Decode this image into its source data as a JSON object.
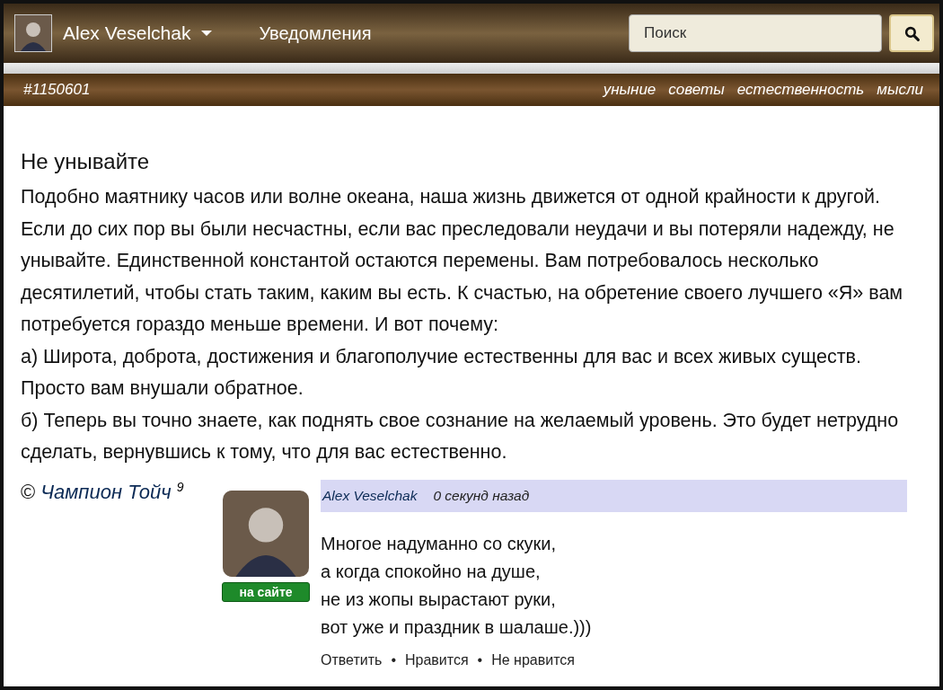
{
  "header": {
    "user": "Alex Veselchak",
    "notifications": "Уведомления",
    "search": {
      "placeholder": "Поиск"
    }
  },
  "post_bar": {
    "id": "#1150601",
    "tags": [
      "уныние",
      "советы",
      "естественность",
      "мысли"
    ]
  },
  "post": {
    "title": "Не унывайте",
    "paragraphs": [
      "Подобно маятнику часов или волне океана, наша жизнь движется от одной крайности к другой. Если до сих пор вы были несчастны, если вас преследовали неудачи и вы потеряли надежду, не унывайте. Единственной константой остаются перемены. Вам потребовалось несколько десятилетий, чтобы стать таким, каким вы есть. К счастью, на обретение своего лучшего «Я» вам потребуется гораздо меньше времени. И вот почему:",
      "а) Широта, доброта, достижения и благополучие естественны для вас и всех живых существ. Просто вам внушали обратное.",
      "б) Теперь вы точно знаете, как поднять свое сознание на желаемый уровень. Это будет нетрудно сделать, вернувшись к тому, что для вас естественно."
    ],
    "copyright": "©",
    "author": "Чампион Тойч",
    "author_count": "9"
  },
  "comment": {
    "author": "Alex Veselchak",
    "time": "0 секунд назад",
    "online": true,
    "online_label": "на сайте",
    "lines": [
      "Многое надуманно со скуки,",
      "а когда спокойно на душе,",
      "не из жопы вырастают руки,",
      "вот уже и праздник в шалаше.)))"
    ],
    "actions": [
      "Ответить",
      "Нравится",
      "Не нравится"
    ],
    "separator": "•"
  }
}
